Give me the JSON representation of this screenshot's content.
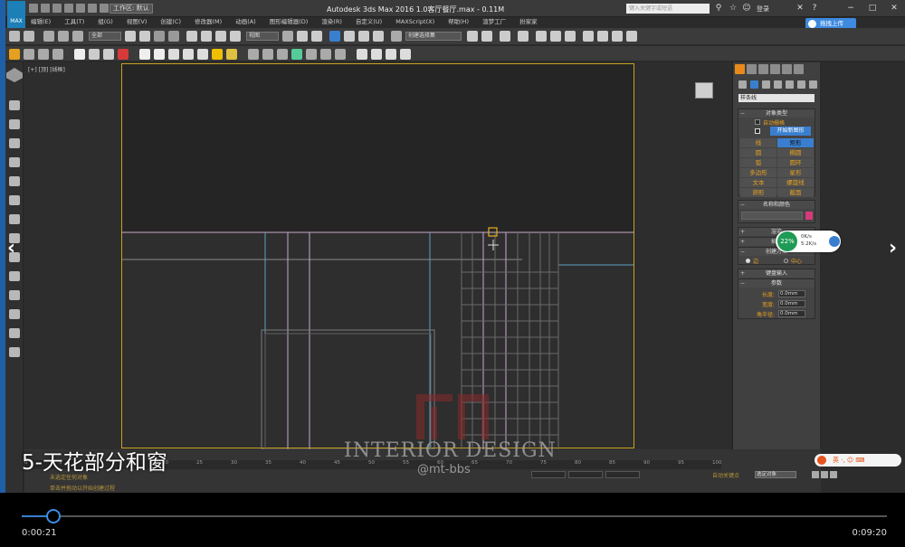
{
  "titlebar": {
    "workspace": "工作区: 默认",
    "app_title": "Autodesk 3ds Max 2016      1.0客厅餐厅.max - 0.11M",
    "search_placeholder": "键入关键字或短语",
    "login": "登录"
  },
  "menu": [
    "编辑(E)",
    "工具(T)",
    "组(G)",
    "视图(V)",
    "创建(C)",
    "修改器(M)",
    "动画(A)",
    "图形编辑器(D)",
    "渲染(R)",
    "自定义(U)",
    "MAXScript(X)",
    "帮助(H)",
    "渲梦工厂",
    "扮家家"
  ],
  "upload_label": "拖拽上传",
  "toolbar": {
    "selection_filter": "全部",
    "view_select": "视图",
    "named_selection": "创建选择集"
  },
  "viewport": {
    "label": "[+] [顶] [线框]"
  },
  "command_panel": {
    "category_dropdown": "样条线",
    "object_type_title": "对象类型",
    "auto_grid": "自动栅格",
    "start_new_shape": "开始新图形",
    "object_buttons": [
      "线",
      "矩形",
      "圆",
      "椭圆",
      "弧",
      "圆环",
      "多边形",
      "星形",
      "文本",
      "螺旋线",
      "卵形",
      "截面"
    ],
    "name_color_title": "名称和颜色",
    "render_title": "渲染",
    "interp_title": "插值",
    "create_method_title": "创建方法",
    "create_edge": "边",
    "create_center": "中心",
    "keyboard_input_title": "键盘输入",
    "params_title": "参数",
    "length_label": "长度:",
    "length_value": "0.0mm",
    "width_label": "宽度:",
    "width_value": "0.0mm",
    "corner_label": "角半径:",
    "corner_value": "0.0mm",
    "name_color": "#d63a7a"
  },
  "net_badge": {
    "percent": "22%",
    "up": "0K/s",
    "down": "5.2K/s"
  },
  "bottom": {
    "ruler_ticks": [
      "0",
      "5",
      "10",
      "15",
      "20",
      "25",
      "30",
      "35",
      "40",
      "45",
      "50",
      "55",
      "60",
      "65",
      "70",
      "75",
      "80",
      "85",
      "90",
      "95",
      "100"
    ],
    "status_line1": "未选定任何对象",
    "status_line2": "单击并拖动以开始创建过程",
    "auto_key": "自动关键点",
    "set_key": "选定对象",
    "ime": "英 ·, ☺ ⌨"
  },
  "overlay": {
    "subtitle": "5-天花部分和窗",
    "watermark": "INTERIOR DESIGN",
    "watermark_sub": "@mt-bbs"
  },
  "video": {
    "current_time": "0:00:21",
    "total_time": "0:09:20",
    "progress": 0.037
  }
}
